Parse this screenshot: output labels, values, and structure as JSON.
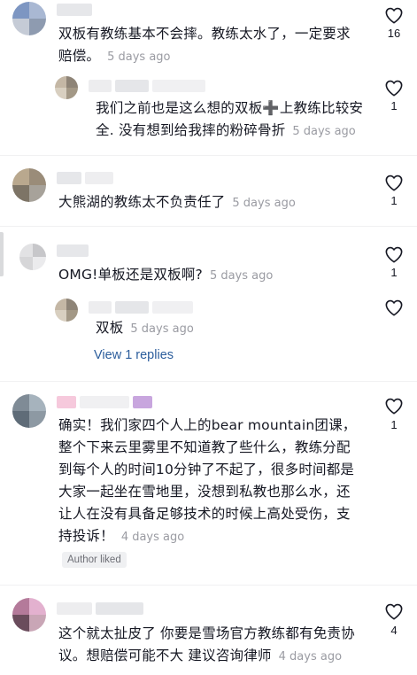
{
  "comments": [
    {
      "text": "双板有教练基本不会摔。教练太水了，一定要求赔偿。",
      "time": "5 days ago",
      "likes": "16"
    },
    {
      "text": "我们之前也是这么想的双板➕上教练比较安全. 没有想到给我摔的粉碎骨折",
      "time": "5 days ago",
      "likes": "1"
    },
    {
      "text": "大熊湖的教练太不负责任了",
      "time": "5 days ago",
      "likes": "1"
    },
    {
      "text": "OMG!单板还是双板啊?",
      "time": "5 days ago",
      "likes": "1"
    },
    {
      "text": "双板",
      "time": "5 days ago",
      "likes": ""
    },
    {
      "text": "确实！我们家四个人上的bear mountain团课，整个下来云里雾里不知道教了些什么，教练分配到每个人的时间10分钟了不起了，很多时间都是大家一起坐在雪地里，没想到私教也那么水，还让人在没有具备足够技术的时候上高处受伤，支持投诉！",
      "time": "4 days ago",
      "likes": "1"
    },
    {
      "text": "这个就太扯皮了 你要是雪场官方教练都有免责协议。想赔偿可能不大 建议咨询律师",
      "time": "4 days ago",
      "likes": "4"
    }
  ],
  "view_replies": "View 1 replies",
  "author_liked": "Author liked",
  "icons": {
    "like": "heart-outline-icon"
  },
  "colors": {
    "link": "#2b5d9c",
    "timestamp": "#9a9ba2",
    "badge_bg": "#eff0f2"
  }
}
